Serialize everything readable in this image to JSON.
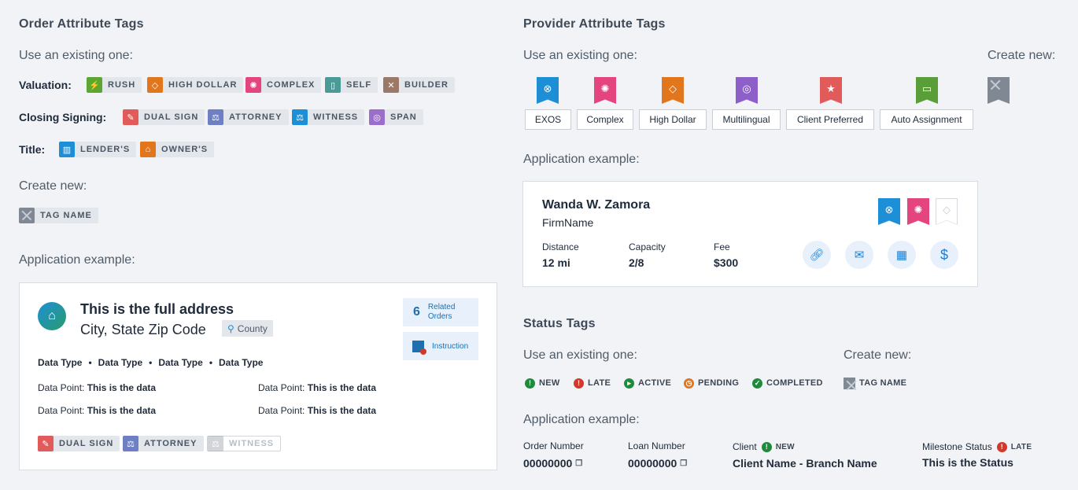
{
  "order": {
    "title": "Order Attribute Tags",
    "use_existing": "Use an existing one:",
    "valuation_label": "Valuation:",
    "valuation_tags": [
      "RUSH",
      "HIGH DOLLAR",
      "COMPLEX",
      "SELF",
      "BUILDER"
    ],
    "closing_label": "Closing Signing:",
    "closing_tags": [
      "DUAL SIGN",
      "ATTORNEY",
      "WITNESS",
      "SPAN"
    ],
    "title_label": "Title:",
    "title_tags": [
      "LENDER'S",
      "OWNER'S"
    ],
    "create_new": "Create new:",
    "new_tag": "TAG NAME",
    "app_example": "Application example:",
    "card": {
      "address": "This is the full address",
      "city": "City, State Zip Code",
      "county": "County",
      "related_count": "6",
      "related_label": "Related Orders",
      "instruction": "Instruction",
      "data_types": [
        "Data Type",
        "Data Type",
        "Data Type",
        "Data Type"
      ],
      "point_label": "Data Point:",
      "point_value": "This is the data",
      "tags": [
        "DUAL SIGN",
        "ATTORNEY",
        "WITNESS"
      ]
    }
  },
  "provider": {
    "title": "Provider Attribute Tags",
    "use_existing": "Use an existing one:",
    "create_new": "Create new:",
    "tags": [
      "EXOS",
      "Complex",
      "High Dollar",
      "Multilingual",
      "Client Preferred",
      "Auto Assignment"
    ],
    "app_example": "Application example:",
    "card": {
      "name": "Wanda W. Zamora",
      "firm": "FirmName",
      "distance_label": "Distance",
      "distance": "12 mi",
      "capacity_label": "Capacity",
      "capacity": "2/8",
      "fee_label": "Fee",
      "fee": "$300"
    }
  },
  "status": {
    "title": "Status Tags",
    "use_existing": "Use an existing one:",
    "create_new": "Create new:",
    "tags": [
      "NEW",
      "LATE",
      "ACTIVE",
      "PENDING",
      "COMPLETED"
    ],
    "new_tag": "TAG NAME",
    "app_example": "Application example:",
    "order_number_label": "Order Number",
    "order_number": "00000000",
    "loan_number_label": "Loan Number",
    "loan_number": "00000000",
    "client_label": "Client",
    "client_tag": "NEW",
    "client_value": "Client Name - Branch Name",
    "milestone_label": "Milestone Status",
    "milestone_tag": "LATE",
    "milestone_value": "This is the Status"
  },
  "colors": {
    "rush": "#5aa832",
    "high_dollar": "#e2761c",
    "complex": "#e5457f",
    "self": "#4a9a98",
    "builder": "#9b7867",
    "dual_sign": "#e25b5b",
    "attorney": "#6f7fc4",
    "witness": "#1d8fd6",
    "span": "#9b6ecb",
    "lenders": "#1d8fd6",
    "owners": "#e2761c",
    "exos": "#1d8fd6",
    "multilingual": "#8c5fc9",
    "client_preferred": "#e25b5b",
    "auto_assignment": "#5a9e3a",
    "status_new": "#1e8a3c",
    "status_late": "#d13a2a",
    "status_active": "#1e8a3c",
    "status_pending": "#e2761c",
    "status_completed": "#1e8a3c"
  }
}
